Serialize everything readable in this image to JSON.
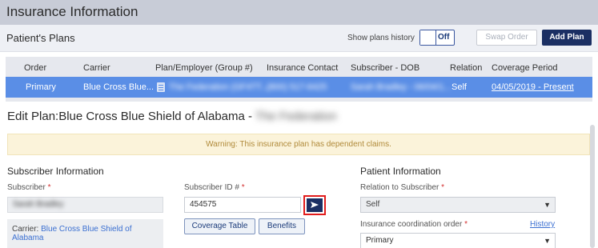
{
  "title": "Insurance Information",
  "plans_header": {
    "title": "Patient's Plans",
    "show_history_label": "Show plans history",
    "toggle_state": "Off",
    "swap_label": "Swap Order",
    "add_label": "Add Plan"
  },
  "table": {
    "columns": [
      "Order",
      "Carrier",
      "Plan/Employer (Group #)",
      "Insurance Contact",
      "Subscriber - DOB",
      "Relation",
      "Coverage Period"
    ],
    "rows": [
      {
        "order": "Primary",
        "carrier": "Blue Cross Blue...",
        "plan": "The Federation (GF4TT...",
        "contact": "(800) 517-6425",
        "subscriber": "Sarah Bradley - 06/04/1...",
        "relation": "Self",
        "coverage": "04/05/2019 - Present"
      }
    ]
  },
  "edit": {
    "title_prefix": "Edit Plan:Blue Cross Blue Shield of Alabama - ",
    "title_employer": "The Federation",
    "warning": "Warning: This insurance plan has dependent claims."
  },
  "subscriber_info": {
    "title": "Subscriber Information",
    "subscriber_label": "Subscriber",
    "subscriber_value": "Sarah Bradley",
    "subscriber_id_label": "Subscriber ID #",
    "subscriber_id_value": "454575",
    "coverage_table_label": "Coverage Table",
    "benefits_label": "Benefits",
    "carrier_label": "Carrier:",
    "carrier_value": "Blue Cross Blue Shield of Alabama"
  },
  "patient_info": {
    "title": "Patient Information",
    "relation_label": "Relation to Subscriber",
    "relation_value": "Self",
    "coord_label": "Insurance coordination order",
    "coord_value": "Primary",
    "history_link": "History"
  },
  "required_mark": "*",
  "colors": {
    "accent": "#1b2f63",
    "selected_row": "#5a8ee6",
    "warning_bg": "#fbf3da",
    "highlight": "#e11c1c"
  }
}
